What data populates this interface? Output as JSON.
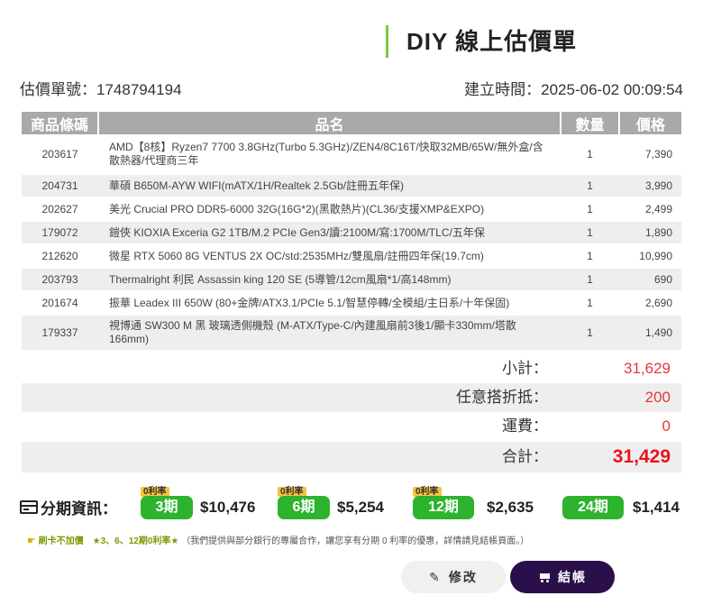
{
  "header": {
    "title": "DIY 線上估價單"
  },
  "meta": {
    "quote_no_label": "估價單號：",
    "quote_no": "1748794194",
    "created_label": "建立時間：",
    "created": "2025-06-02 00:09:54"
  },
  "table": {
    "headers": {
      "code": "商品條碼",
      "name": "品名",
      "qty": "數量",
      "price": "價格"
    },
    "rows": [
      {
        "code": "203617",
        "name": "AMD【8核】Ryzen7 7700 3.8GHz(Turbo 5.3GHz)/ZEN4/8C16T/快取32MB/65W/無外盒/含散熱器/代理商三年",
        "qty": "1",
        "price": "7,390"
      },
      {
        "code": "204731",
        "name": "華碩 B650M-AYW WIFI(mATX/1H/Realtek 2.5Gb/註冊五年保)",
        "qty": "1",
        "price": "3,990"
      },
      {
        "code": "202627",
        "name": "美光 Crucial PRO DDR5-6000 32G(16G*2)(黑散熱片)(CL36/支援XMP&EXPO)",
        "qty": "1",
        "price": "2,499"
      },
      {
        "code": "179072",
        "name": "鎧俠 KIOXIA Exceria G2 1TB/M.2 PCIe Gen3/讀:2100M/寫:1700M/TLC/五年保",
        "qty": "1",
        "price": "1,890"
      },
      {
        "code": "212620",
        "name": "微星 RTX 5060 8G VENTUS 2X OC/std:2535MHz/雙風扇/註冊四年保(19.7cm)",
        "qty": "1",
        "price": "10,990"
      },
      {
        "code": "203793",
        "name": "Thermalright 利民 Assassin king 120 SE (5導管/12cm風扇*1/高148mm)",
        "qty": "1",
        "price": "690"
      },
      {
        "code": "201674",
        "name": "振華 Leadex III 650W (80+金牌/ATX3.1/PCIe 5.1/智慧停轉/全模組/主日系/十年保固)",
        "qty": "1",
        "price": "2,690"
      },
      {
        "code": "179337",
        "name": "視博通 SW300 M 黑 玻璃透側機殼 (M-ATX/Type-C/內建風扇前3後1/顯卡330mm/塔散166mm)",
        "qty": "1",
        "price": "1,490"
      }
    ]
  },
  "summary": {
    "subtotal_label": "小計：",
    "subtotal": "31,629",
    "discount_label": "任意搭折抵：",
    "discount": "200",
    "shipping_label": "運費：",
    "shipping": "0",
    "total_label": "合計：",
    "total": "31,429"
  },
  "installment": {
    "label": "分期資訊：",
    "plans": [
      {
        "tag": "0利率",
        "period": "3期",
        "amount": "$10,476"
      },
      {
        "tag": "0利率",
        "period": "6期",
        "amount": "$5,254"
      },
      {
        "tag": "0利率",
        "period": "12期",
        "amount": "$2,635"
      },
      {
        "tag": "",
        "period": "24期",
        "amount": "$1,414"
      }
    ]
  },
  "notice": {
    "strong": "刷卡不加價　★3、6、12期0利率★",
    "text": "（我們提供與部分銀行的專屬合作，讓您享有分期 0 利率的優惠，詳情請見結帳頁面。）"
  },
  "buttons": {
    "edit": "修改",
    "checkout": "結帳"
  },
  "colors": {
    "accent_green": "#2db32d",
    "title_bar": "#7ac943",
    "checkout_bg": "#2a0f4a",
    "price_red": "#e8141c",
    "badge_yellow": "#f6c23e"
  }
}
